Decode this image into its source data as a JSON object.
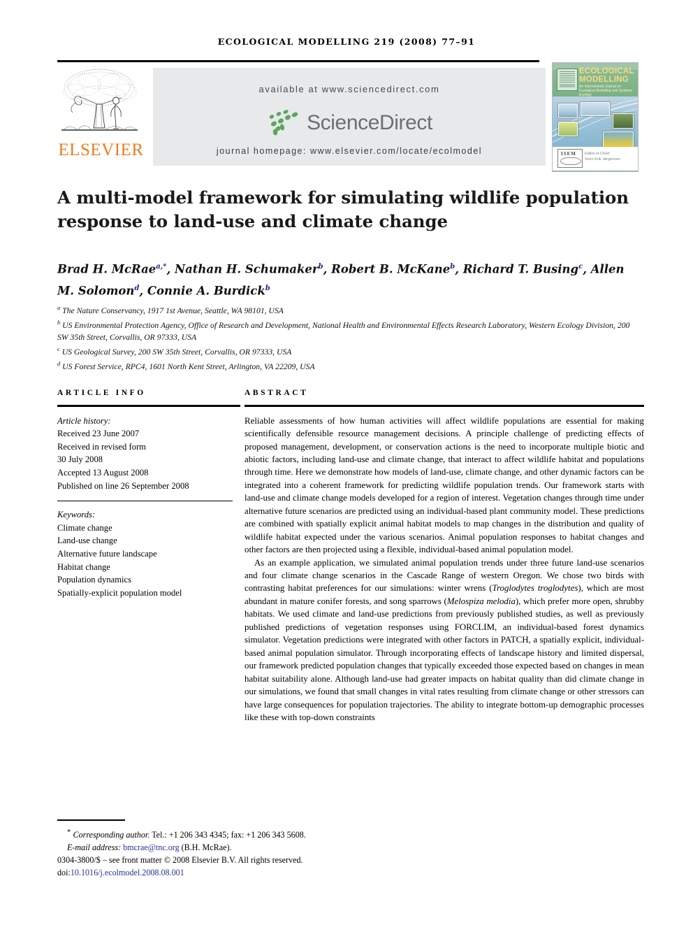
{
  "running_head": "ECOLOGICAL MODELLING 219 (2008) 77–91",
  "masthead": {
    "publisher_name": "ELSEVIER",
    "publisher_logo_alt": "elsevier-tree-logo",
    "available_at": "available at www.sciencedirect.com",
    "sciencedirect_wordmark": "ScienceDirect",
    "journal_homepage": "journal homepage: www.elsevier.com/locate/ecolmodel",
    "cover": {
      "title_line1": "ECOLOGICAL",
      "title_line2": "MODELLING",
      "subtitle": "An International Journal on Ecological Modelling and Systems Ecology",
      "society": "ISEM",
      "editor_line1": "Editor-in-Chief",
      "editor_line2": "Sven Erik Jørgensen"
    },
    "colors": {
      "elsevier_orange": "#f07c1e",
      "sciencedirect_green": "#57a05a",
      "sciencedirect_gray": "#6d6e70",
      "banner_gray": "#e8e9ea"
    }
  },
  "article": {
    "title": "A multi-model framework for simulating wildlife population response to land-use and climate change",
    "authors": [
      {
        "name": "Brad H. McRae",
        "marks": "a,*"
      },
      {
        "name": "Nathan H. Schumaker",
        "marks": "b"
      },
      {
        "name": "Robert B. McKane",
        "marks": "b"
      },
      {
        "name": "Richard T. Busing",
        "marks": "c"
      },
      {
        "name": "Allen M. Solomon",
        "marks": "d"
      },
      {
        "name": "Connie A. Burdick",
        "marks": "b"
      }
    ],
    "affiliations": [
      {
        "mark": "a",
        "text": "The Nature Conservancy, 1917 1st Avenue, Seattle, WA 98101, USA"
      },
      {
        "mark": "b",
        "text": "US Environmental Protection Agency, Office of Research and Development, National Health and Environmental Effects Research Laboratory, Western Ecology Division, 200 SW 35th Street, Corvallis, OR 97333, USA"
      },
      {
        "mark": "c",
        "text": "US Geological Survey, 200 SW 35th Street, Corvallis, OR 97333, USA"
      },
      {
        "mark": "d",
        "text": "US Forest Service, RPC4, 1601 North Kent Street, Arlington, VA 22209, USA"
      }
    ]
  },
  "article_info": {
    "heading": "ARTICLE INFO",
    "history_label": "Article history:",
    "history": [
      "Received 23 June 2007",
      "Received in revised form",
      "30 July 2008",
      "Accepted 13 August 2008",
      "Published on line 26 September 2008"
    ],
    "keywords_label": "Keywords:",
    "keywords": [
      "Climate change",
      "Land-use change",
      "Alternative future landscape",
      "Habitat change",
      "Population dynamics",
      "Spatially-explicit population model"
    ]
  },
  "abstract": {
    "heading": "ABSTRACT",
    "paragraph_1_a": "Reliable assessments of how human activities will affect wildlife populations are essential for making scientifically defensible resource management decisions. A principle challenge of predicting effects of proposed management, development, or conservation actions is the need to incorporate multiple biotic and abiotic factors, including land-use and climate change, that interact to affect wildlife habitat and populations through time. Here we demonstrate how models of land-use, climate change, and other dynamic factors can be integrated into a coherent framework for predicting wildlife population trends. Our framework starts with land-use and climate change models developed for a region of interest. Vegetation changes through time under alternative future scenarios are predicted using an individual-based plant community model. These predictions are combined with spatially explicit animal habitat models to map changes in the distribution and quality of wildlife habitat expected under the various scenarios. Animal population responses to habitat changes and other factors are then projected using a flexible, individual-based animal population model.",
    "paragraph_2_a": "As an example application, we simulated animal population trends under three future land-use scenarios and four climate change scenarios in the Cascade Range of western Oregon. We chose two birds with contrasting habitat preferences for our simulations: winter wrens (",
    "paragraph_2_sp1": "Troglodytes troglodytes",
    "paragraph_2_b": "), which are most abundant in mature conifer forests, and song sparrows (",
    "paragraph_2_sp2": "Melospiza melodia",
    "paragraph_2_c": "), which prefer more open, shrubby habitats. We used climate and land-use predictions from previously published studies, as well as previously published predictions of vegetation responses using FORCLIM, an individual-based forest dynamics simulator. Vegetation predictions were integrated with other factors in PATCH, a spatially explicit, individual-based animal population simulator. Through incorporating effects of landscape history and limited dispersal, our framework predicted population changes that typically exceeded those expected based on changes in mean habitat suitability alone. Although land-use had greater impacts on habitat quality than did climate change in our simulations, we found that small changes in vital rates resulting from climate change or other stressors can have large consequences for population trajectories. The ability to integrate bottom-up demographic processes like these with top-down constraints"
  },
  "footer": {
    "corresponding_mark": "*",
    "corresponding_label": "Corresponding author.",
    "corresponding_tel": " Tel.: +1 206 343 4345; fax: +1 206 343 5608.",
    "email_label": "E-mail address:",
    "email": "bmcrae@tnc.org",
    "email_owner": "(B.H. McRae).",
    "copyright": "0304-3800/$ – see front matter © 2008 Elsevier B.V. All rights reserved.",
    "doi_label": "doi:",
    "doi": "10.1016/j.ecolmodel.2008.08.001"
  }
}
